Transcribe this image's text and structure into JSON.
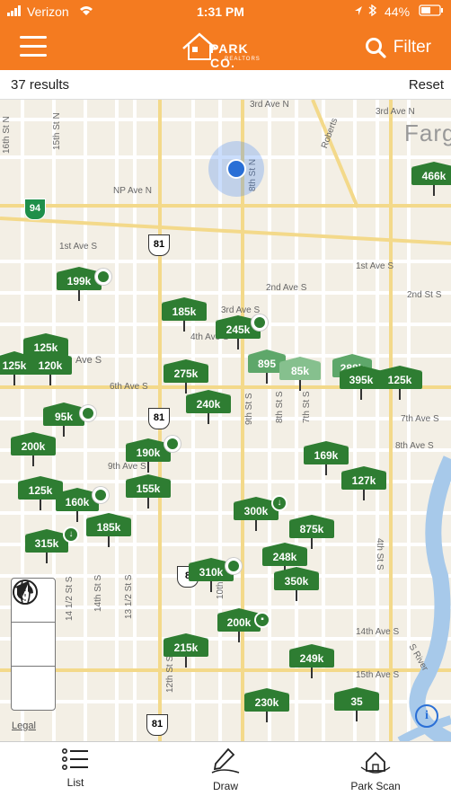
{
  "status": {
    "carrier": "Verizon",
    "time": "1:31 PM",
    "battery": "44%"
  },
  "header": {
    "logo_main": "PARK CO.",
    "logo_sub": "REALTORS",
    "filter_label": "Filter"
  },
  "results_bar": {
    "count": "37 results",
    "reset": "Reset"
  },
  "map": {
    "city_label": "Farg",
    "streets": [
      "3rd Ave N",
      "3rd Ave N",
      "NP Ave N",
      "1st Ave S",
      "1st Ave S",
      "2nd Ave S",
      "2nd St S",
      "3rd Ave S",
      "4th Ave S",
      "Ave S",
      "6th Ave S",
      "7th Ave S",
      "8th Ave S",
      "9th Ave S",
      "14th Ave S",
      "15th Ave S",
      "16th St N",
      "15th St N",
      "8th St N",
      "Roberts",
      "9th St S",
      "8th St S",
      "7th St S",
      "4th St S",
      "14 1/2 St S",
      "14th St S",
      "13 1/2 St S",
      "12th St S",
      "10th",
      "S River"
    ],
    "shields": [
      "94",
      "81",
      "81",
      "8",
      "81"
    ],
    "pins": [
      "466k",
      "199k",
      "185k",
      "245k",
      "125k",
      "125k",
      "120k",
      "275k",
      "895",
      "85k",
      "288k",
      "395k",
      "125k",
      "240k",
      "95k",
      "200k",
      "190k",
      "169k",
      "155k",
      "125k",
      "127k",
      "160k",
      "185k",
      "315k",
      "300k",
      "875k",
      "248k",
      "310k",
      "350k",
      "200k",
      "215k",
      "249k",
      "230k",
      "35"
    ],
    "legal": "Legal",
    "info": "i"
  },
  "tabs": {
    "list": "List",
    "draw": "Draw",
    "scan": "Park Scan"
  }
}
